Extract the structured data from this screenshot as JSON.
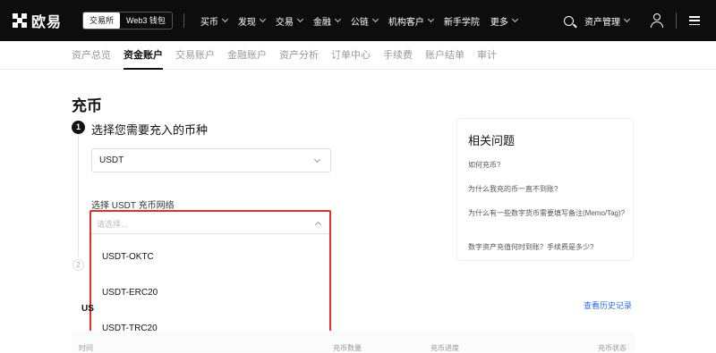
{
  "topbar": {
    "brand": "欧易",
    "switch": [
      "交易所",
      "Web3 钱包"
    ],
    "nav": [
      "买币",
      "发现",
      "交易",
      "金融",
      "公链",
      "机构客户",
      "新手学院",
      "更多"
    ],
    "nav_has_chevron": [
      true,
      true,
      true,
      true,
      true,
      true,
      false,
      true
    ],
    "asset_menu": "资产管理"
  },
  "subnav": {
    "items": [
      "资产总览",
      "资金账户",
      "交易账户",
      "金融账户",
      "资产分析",
      "订单中心",
      "手续费",
      "账户结单",
      "审计"
    ],
    "active_index": 1
  },
  "page": {
    "title": "充币",
    "step1_number": "1",
    "step1_label": "选择您需要充入的币种",
    "step2_number": "2",
    "coin_value": "USDT",
    "network_label": "选择 USDT 充币网络",
    "network_placeholder": "请选择...",
    "network_options": [
      "USDT-OKTC",
      "USDT-ERC20",
      "USDT-TRC20"
    ]
  },
  "faq": {
    "title": "相关问题",
    "questions": [
      "如何充币?",
      "为什么我充的币一直不到账?",
      "为什么有一些数字货币需要填写备注(Memo/Tag)?",
      "数字资产充值何时到账？手续费是多少?"
    ]
  },
  "history": {
    "partial_title": "US",
    "link": "查看历史记录",
    "columns": [
      "时间",
      "充币数量",
      "充币进度",
      "充币状态"
    ]
  },
  "colors": {
    "accent_blue": "#2b6de8",
    "highlight_red": "#d9322c",
    "topbar_bg": "#0d0d0d"
  }
}
